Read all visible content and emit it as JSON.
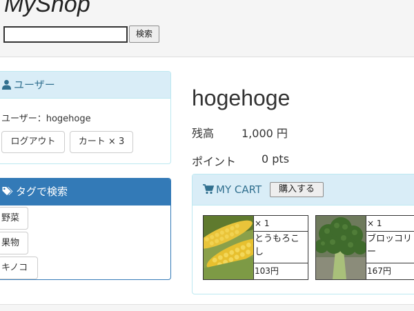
{
  "header": {
    "logo": "MyShop",
    "search": {
      "value": "",
      "placeholder": "",
      "button_label": "検索"
    }
  },
  "user_panel": {
    "title": "ユーザー",
    "user_text": "ユーザー：hogehoge",
    "logout_label": "ログアウト",
    "cart_label": "カート × 3"
  },
  "tag_panel": {
    "title": "タグで検索",
    "tags": [
      "野菜",
      "果物",
      "キノコ"
    ]
  },
  "main": {
    "username": "hogehoge",
    "balance": {
      "label": "残高",
      "value": "1,000 円"
    },
    "points": {
      "label": "ポイント",
      "value": "0 pts"
    }
  },
  "cart": {
    "title": "MY CART",
    "buy_label": "購入する",
    "items": [
      {
        "qty": "× 1",
        "name": "とうもろこし",
        "price": "103円",
        "image": "corn"
      },
      {
        "qty": "× 1",
        "name": "ブロッコリー",
        "price": "167円",
        "image": "broccoli"
      }
    ]
  },
  "colors": {
    "info_bg": "#d9edf7",
    "info_text": "#31708f",
    "primary": "#337ab7"
  }
}
